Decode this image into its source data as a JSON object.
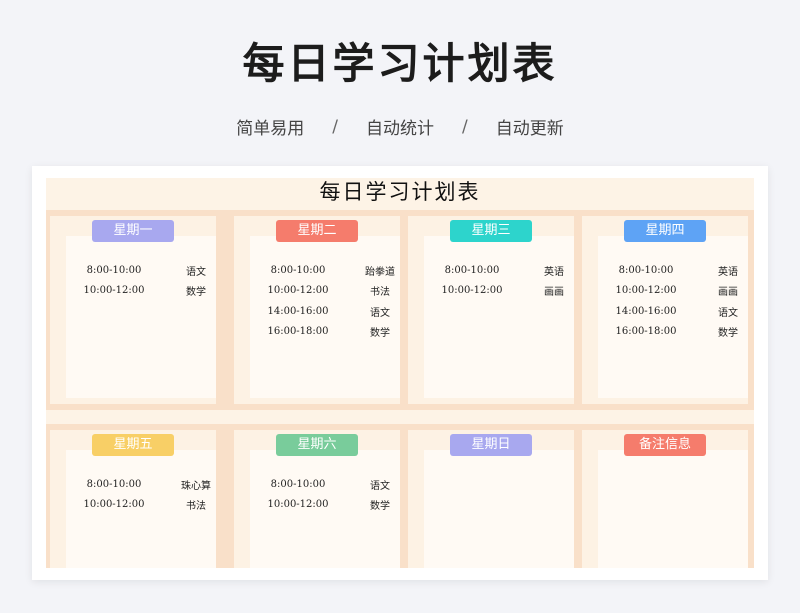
{
  "header": {
    "title": "每日学习计划表",
    "tags": [
      "简单易用",
      "自动统计",
      "自动更新"
    ],
    "separator": "/"
  },
  "sheet": {
    "title": "每日学习计划表",
    "days": [
      {
        "label": "星期一",
        "color": "#a8a8ef",
        "entries": [
          {
            "time": "8:00-10:00",
            "subject": "语文"
          },
          {
            "time": "10:00-12:00",
            "subject": "数学"
          }
        ]
      },
      {
        "label": "星期二",
        "color": "#f57c6c",
        "entries": [
          {
            "time": "8:00-10:00",
            "subject": "跆拳道"
          },
          {
            "time": "10:00-12:00",
            "subject": "书法"
          },
          {
            "time": "14:00-16:00",
            "subject": "语文"
          },
          {
            "time": "16:00-18:00",
            "subject": "数学"
          }
        ]
      },
      {
        "label": "星期三",
        "color": "#2dd4cc",
        "entries": [
          {
            "time": "8:00-10:00",
            "subject": "英语"
          },
          {
            "time": "10:00-12:00",
            "subject": "画画"
          }
        ]
      },
      {
        "label": "星期四",
        "color": "#5ea3f5",
        "entries": [
          {
            "time": "8:00-10:00",
            "subject": "英语"
          },
          {
            "time": "10:00-12:00",
            "subject": "画画"
          },
          {
            "time": "14:00-16:00",
            "subject": "语文"
          },
          {
            "time": "16:00-18:00",
            "subject": "数学"
          }
        ]
      },
      {
        "label": "星期五",
        "color": "#f8cf66",
        "entries": [
          {
            "time": "8:00-10:00",
            "subject": "珠心算"
          },
          {
            "time": "10:00-12:00",
            "subject": "书法"
          }
        ]
      },
      {
        "label": "星期六",
        "color": "#79cc9b",
        "entries": [
          {
            "time": "8:00-10:00",
            "subject": "语文"
          },
          {
            "time": "10:00-12:00",
            "subject": "数学"
          }
        ]
      },
      {
        "label": "星期日",
        "color": "#a8a8ef",
        "entries": []
      },
      {
        "label": "备注信息",
        "color": "#f57c6c",
        "entries": []
      }
    ]
  }
}
